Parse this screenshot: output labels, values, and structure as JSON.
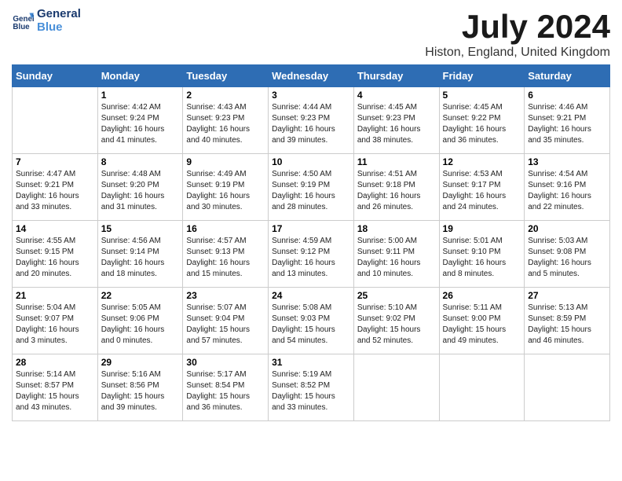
{
  "logo": {
    "line1": "General",
    "line2": "Blue"
  },
  "title": "July 2024",
  "subtitle": "Histon, England, United Kingdom",
  "days_of_week": [
    "Sunday",
    "Monday",
    "Tuesday",
    "Wednesday",
    "Thursday",
    "Friday",
    "Saturday"
  ],
  "weeks": [
    [
      {
        "day": "",
        "info": ""
      },
      {
        "day": "1",
        "info": "Sunrise: 4:42 AM\nSunset: 9:24 PM\nDaylight: 16 hours\nand 41 minutes."
      },
      {
        "day": "2",
        "info": "Sunrise: 4:43 AM\nSunset: 9:23 PM\nDaylight: 16 hours\nand 40 minutes."
      },
      {
        "day": "3",
        "info": "Sunrise: 4:44 AM\nSunset: 9:23 PM\nDaylight: 16 hours\nand 39 minutes."
      },
      {
        "day": "4",
        "info": "Sunrise: 4:45 AM\nSunset: 9:23 PM\nDaylight: 16 hours\nand 38 minutes."
      },
      {
        "day": "5",
        "info": "Sunrise: 4:45 AM\nSunset: 9:22 PM\nDaylight: 16 hours\nand 36 minutes."
      },
      {
        "day": "6",
        "info": "Sunrise: 4:46 AM\nSunset: 9:21 PM\nDaylight: 16 hours\nand 35 minutes."
      }
    ],
    [
      {
        "day": "7",
        "info": "Sunrise: 4:47 AM\nSunset: 9:21 PM\nDaylight: 16 hours\nand 33 minutes."
      },
      {
        "day": "8",
        "info": "Sunrise: 4:48 AM\nSunset: 9:20 PM\nDaylight: 16 hours\nand 31 minutes."
      },
      {
        "day": "9",
        "info": "Sunrise: 4:49 AM\nSunset: 9:19 PM\nDaylight: 16 hours\nand 30 minutes."
      },
      {
        "day": "10",
        "info": "Sunrise: 4:50 AM\nSunset: 9:19 PM\nDaylight: 16 hours\nand 28 minutes."
      },
      {
        "day": "11",
        "info": "Sunrise: 4:51 AM\nSunset: 9:18 PM\nDaylight: 16 hours\nand 26 minutes."
      },
      {
        "day": "12",
        "info": "Sunrise: 4:53 AM\nSunset: 9:17 PM\nDaylight: 16 hours\nand 24 minutes."
      },
      {
        "day": "13",
        "info": "Sunrise: 4:54 AM\nSunset: 9:16 PM\nDaylight: 16 hours\nand 22 minutes."
      }
    ],
    [
      {
        "day": "14",
        "info": "Sunrise: 4:55 AM\nSunset: 9:15 PM\nDaylight: 16 hours\nand 20 minutes."
      },
      {
        "day": "15",
        "info": "Sunrise: 4:56 AM\nSunset: 9:14 PM\nDaylight: 16 hours\nand 18 minutes."
      },
      {
        "day": "16",
        "info": "Sunrise: 4:57 AM\nSunset: 9:13 PM\nDaylight: 16 hours\nand 15 minutes."
      },
      {
        "day": "17",
        "info": "Sunrise: 4:59 AM\nSunset: 9:12 PM\nDaylight: 16 hours\nand 13 minutes."
      },
      {
        "day": "18",
        "info": "Sunrise: 5:00 AM\nSunset: 9:11 PM\nDaylight: 16 hours\nand 10 minutes."
      },
      {
        "day": "19",
        "info": "Sunrise: 5:01 AM\nSunset: 9:10 PM\nDaylight: 16 hours\nand 8 minutes."
      },
      {
        "day": "20",
        "info": "Sunrise: 5:03 AM\nSunset: 9:08 PM\nDaylight: 16 hours\nand 5 minutes."
      }
    ],
    [
      {
        "day": "21",
        "info": "Sunrise: 5:04 AM\nSunset: 9:07 PM\nDaylight: 16 hours\nand 3 minutes."
      },
      {
        "day": "22",
        "info": "Sunrise: 5:05 AM\nSunset: 9:06 PM\nDaylight: 16 hours\nand 0 minutes."
      },
      {
        "day": "23",
        "info": "Sunrise: 5:07 AM\nSunset: 9:04 PM\nDaylight: 15 hours\nand 57 minutes."
      },
      {
        "day": "24",
        "info": "Sunrise: 5:08 AM\nSunset: 9:03 PM\nDaylight: 15 hours\nand 54 minutes."
      },
      {
        "day": "25",
        "info": "Sunrise: 5:10 AM\nSunset: 9:02 PM\nDaylight: 15 hours\nand 52 minutes."
      },
      {
        "day": "26",
        "info": "Sunrise: 5:11 AM\nSunset: 9:00 PM\nDaylight: 15 hours\nand 49 minutes."
      },
      {
        "day": "27",
        "info": "Sunrise: 5:13 AM\nSunset: 8:59 PM\nDaylight: 15 hours\nand 46 minutes."
      }
    ],
    [
      {
        "day": "28",
        "info": "Sunrise: 5:14 AM\nSunset: 8:57 PM\nDaylight: 15 hours\nand 43 minutes."
      },
      {
        "day": "29",
        "info": "Sunrise: 5:16 AM\nSunset: 8:56 PM\nDaylight: 15 hours\nand 39 minutes."
      },
      {
        "day": "30",
        "info": "Sunrise: 5:17 AM\nSunset: 8:54 PM\nDaylight: 15 hours\nand 36 minutes."
      },
      {
        "day": "31",
        "info": "Sunrise: 5:19 AM\nSunset: 8:52 PM\nDaylight: 15 hours\nand 33 minutes."
      },
      {
        "day": "",
        "info": ""
      },
      {
        "day": "",
        "info": ""
      },
      {
        "day": "",
        "info": ""
      }
    ]
  ]
}
